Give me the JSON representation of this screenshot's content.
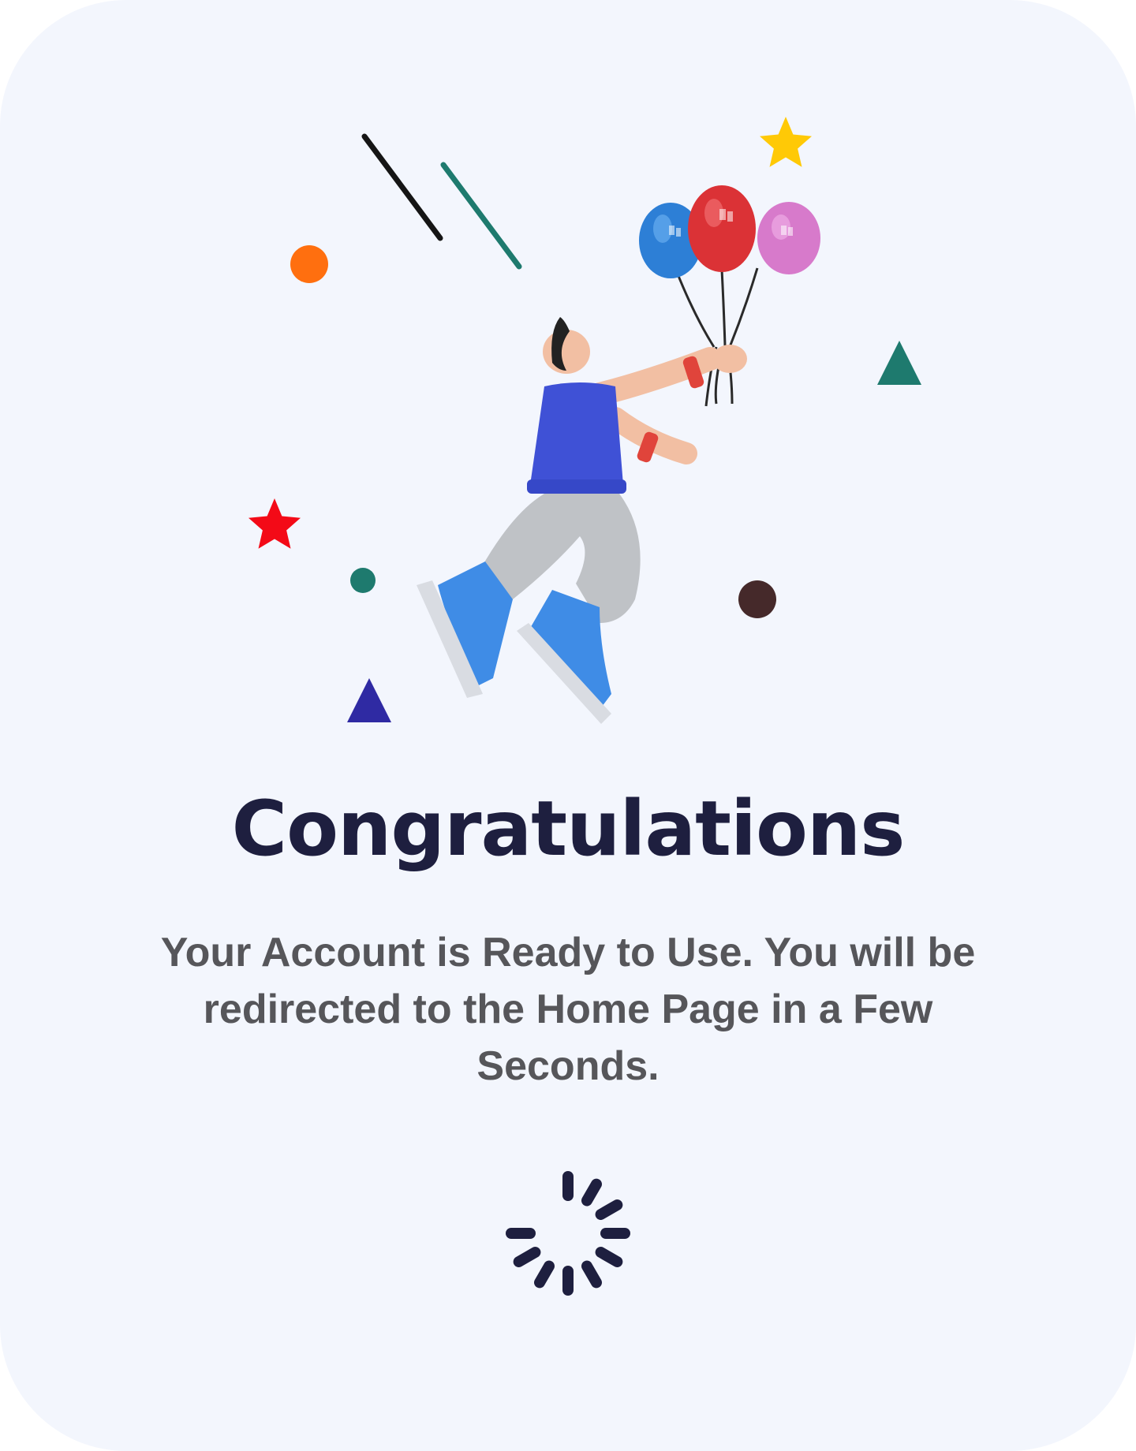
{
  "title": "Congratulations",
  "message": "Your Account is Ready to Use. You will be redirected to the Home Page in a Few Seconds.",
  "illustration": {
    "subject": "person-floating-with-balloons",
    "icons": [
      "star-icon",
      "triangle-icon",
      "circle-icon",
      "balloon-icon"
    ]
  },
  "colors": {
    "background": "#F3F6FD",
    "title": "#1E1F3F",
    "message": "#56565A",
    "spinner": "#1E1F3F"
  }
}
